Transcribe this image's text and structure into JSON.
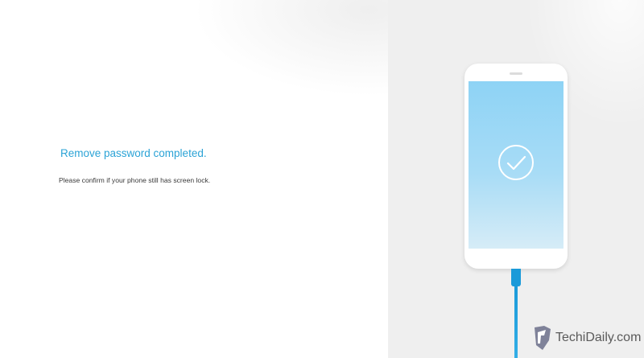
{
  "main": {
    "title": "Remove password completed.",
    "message": "Please confirm if your phone still has screen lock."
  },
  "illustration": {
    "status_icon": "check-circle-icon",
    "accent_color": "#2ba3d6",
    "screen_color": "#8ed3f5",
    "cable_color": "#1a9ad9"
  },
  "watermark": {
    "text": "TechiDaily.com"
  }
}
